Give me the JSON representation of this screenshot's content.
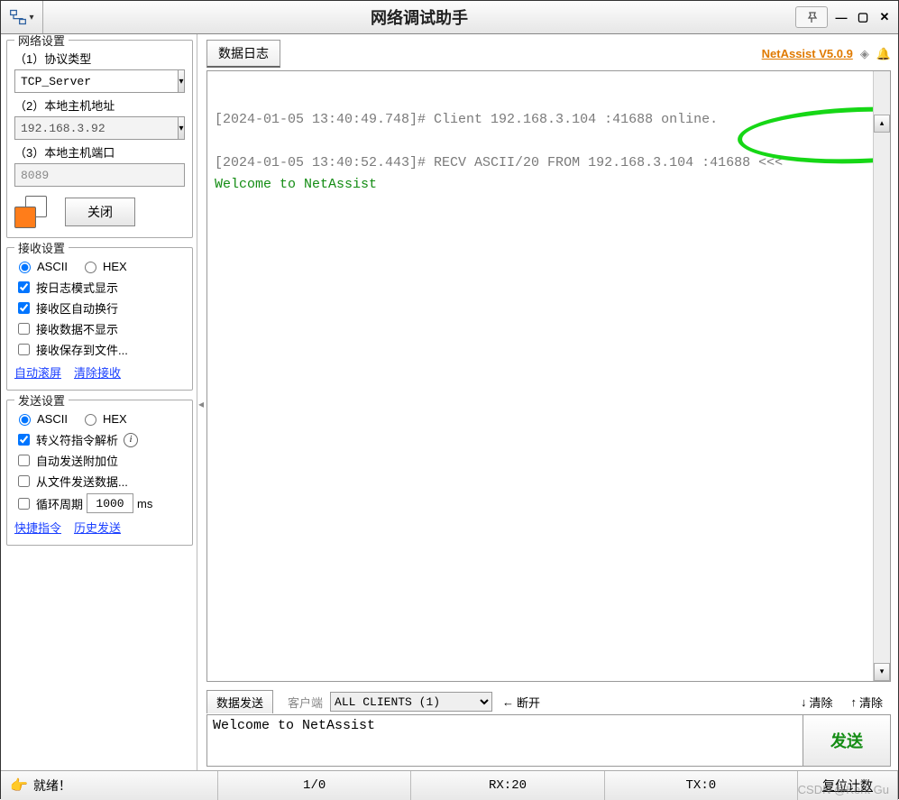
{
  "title": "网络调试助手",
  "brand_link": "NetAssist V5.0.9",
  "network": {
    "legend": "网络设置",
    "proto_label": "（1）协议类型",
    "proto_value": "TCP_Server",
    "host_label": "（2）本地主机地址",
    "host_value": "192.168.3.92",
    "port_label": "（3）本地主机端口",
    "port_value": "8089",
    "close_btn": "关闭"
  },
  "recv": {
    "legend": "接收设置",
    "ascii": "ASCII",
    "hex": "HEX",
    "opt_logmode": "按日志模式显示",
    "opt_wrap": "接收区自动换行",
    "opt_hide": "接收数据不显示",
    "opt_save": "接收保存到文件...",
    "link_autoscroll": "自动滚屏",
    "link_clear": "清除接收"
  },
  "sendcfg": {
    "legend": "发送设置",
    "ascii": "ASCII",
    "hex": "HEX",
    "opt_escape": "转义符指令解析",
    "opt_append": "自动发送附加位",
    "opt_fromfile": "从文件发送数据...",
    "opt_loop_label1": "循环周期",
    "opt_loop_value": "1000",
    "opt_loop_label2": "ms",
    "link_shortcut": "快捷指令",
    "link_history": "历史发送"
  },
  "log_tab": "数据日志",
  "log_lines": {
    "l1": "[2024-01-05 13:40:49.748]# Client 192.168.3.104 :41688 online.",
    "l2a": "[2024-01-05 13:40:52.443]# RECV ASCII/20 FROM 192.168.3.104 :41688 ",
    "l2b": "<<<",
    "l3": "Welcome to NetAssist"
  },
  "send": {
    "tab": "数据发送",
    "client_label": "客户端",
    "client_value": "ALL CLIENTS (1)",
    "disconnect": "断开",
    "clear1": "清除",
    "clear2": "清除",
    "input_value": "Welcome to NetAssist",
    "send_btn": "发送"
  },
  "status": {
    "ready": "就绪！",
    "ratio": "1/0",
    "rx": "RX:20",
    "tx": "TX:0",
    "reset": "复位计数"
  },
  "watermark": "CSDN @Kent Gu"
}
